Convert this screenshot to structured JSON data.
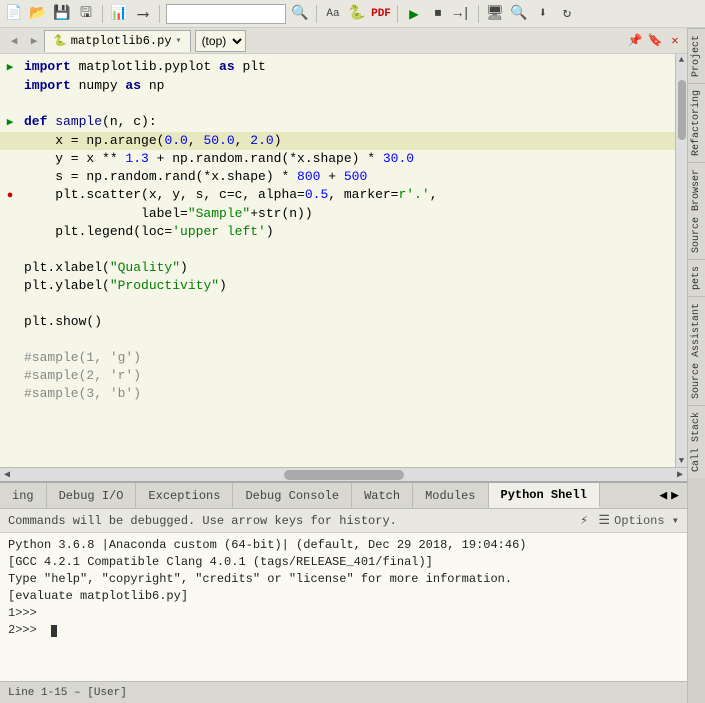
{
  "toolbar": {
    "search_placeholder": "",
    "file_tab": {
      "icon": "🐍",
      "name": "matplotlib6.py",
      "arrow": "▾",
      "scope": "(top)",
      "scope_arrow": "▾"
    },
    "tab_controls": {
      "pin": "📌",
      "bookmark": "🔖",
      "close": "✕"
    }
  },
  "code": {
    "lines": [
      {
        "num": "",
        "gutter": "▶",
        "gutter_type": "arrow",
        "content": "import matplotlib.pyplot as plt",
        "tokens": [
          {
            "t": "kw",
            "v": "import"
          },
          {
            "t": "plain",
            "v": " matplotlib.pyplot "
          },
          {
            "t": "kw",
            "v": "as"
          },
          {
            "t": "plain",
            "v": " plt"
          }
        ]
      },
      {
        "num": "",
        "gutter": "",
        "gutter_type": "",
        "content": "import numpy as np",
        "tokens": [
          {
            "t": "kw",
            "v": "import"
          },
          {
            "t": "plain",
            "v": " numpy "
          },
          {
            "t": "kw",
            "v": "as"
          },
          {
            "t": "plain",
            "v": " np"
          }
        ]
      },
      {
        "num": "",
        "gutter": "",
        "gutter_type": "",
        "content": "",
        "tokens": []
      },
      {
        "num": "▶",
        "gutter": "▶",
        "gutter_type": "arrow",
        "content": "def sample(n, c):",
        "tokens": [
          {
            "t": "kw",
            "v": "def"
          },
          {
            "t": "plain",
            "v": " "
          },
          {
            "t": "fn",
            "v": "sample"
          },
          {
            "t": "plain",
            "v": "(n, c):"
          }
        ]
      },
      {
        "num": "",
        "gutter": "",
        "gutter_type": "highlight",
        "content": "    x = np.arange(0.0, 50.0, 2.0)",
        "tokens": [
          {
            "t": "plain",
            "v": "    x = np.arange("
          },
          {
            "t": "num",
            "v": "0.0"
          },
          {
            "t": "plain",
            "v": ", "
          },
          {
            "t": "num",
            "v": "50.0"
          },
          {
            "t": "plain",
            "v": ", "
          },
          {
            "t": "num",
            "v": "2.0"
          },
          {
            "t": "plain",
            "v": ")"
          }
        ]
      },
      {
        "num": "",
        "gutter": "",
        "gutter_type": "",
        "content": "    y = x ** 1.3 + np.random.rand(*x.shape) * 30.0",
        "tokens": [
          {
            "t": "plain",
            "v": "    y = x ** "
          },
          {
            "t": "num",
            "v": "1.3"
          },
          {
            "t": "plain",
            "v": " + np.random.rand(*x.shape) * "
          },
          {
            "t": "num",
            "v": "30.0"
          }
        ]
      },
      {
        "num": "",
        "gutter": "",
        "gutter_type": "",
        "content": "    s = np.random.rand(*x.shape) * 800 + 500",
        "tokens": [
          {
            "t": "plain",
            "v": "    s = np.random.rand(*x.shape) * "
          },
          {
            "t": "num",
            "v": "800"
          },
          {
            "t": "plain",
            "v": " + "
          },
          {
            "t": "num",
            "v": "500"
          }
        ]
      },
      {
        "num": "●",
        "gutter": "●",
        "gutter_type": "breakpoint",
        "content": "    plt.scatter(x, y, s, c=c, alpha=0.5, marker=r'.','",
        "tokens": [
          {
            "t": "plain",
            "v": "    plt.scatter(x, y, s, c=c, alpha="
          },
          {
            "t": "num",
            "v": "0.5"
          },
          {
            "t": "plain",
            "v": ", marker="
          },
          {
            "t": "str",
            "v": "r'.'"
          },
          {
            "t": "plain",
            "v": ","
          }
        ]
      },
      {
        "num": "",
        "gutter": "",
        "gutter_type": "",
        "content": "                label=\"Sample\"+str(n))",
        "tokens": [
          {
            "t": "plain",
            "v": "                label="
          },
          {
            "t": "str",
            "v": "\"Sample\""
          },
          {
            "t": "plain",
            "v": "+str(n))"
          }
        ]
      },
      {
        "num": "",
        "gutter": "",
        "gutter_type": "",
        "content": "    plt.legend(loc='upper left')",
        "tokens": [
          {
            "t": "plain",
            "v": "    plt.legend(loc="
          },
          {
            "t": "str",
            "v": "'upper left'"
          },
          {
            "t": "plain",
            "v": ")"
          }
        ]
      },
      {
        "num": "",
        "gutter": "",
        "gutter_type": "",
        "content": "",
        "tokens": []
      },
      {
        "num": "",
        "gutter": "",
        "gutter_type": "",
        "content": "plt.xlabel(\"Quality\")",
        "tokens": [
          {
            "t": "plain",
            "v": "plt.xlabel("
          },
          {
            "t": "str",
            "v": "\"Quality\""
          },
          {
            "t": "plain",
            "v": ")"
          }
        ]
      },
      {
        "num": "",
        "gutter": "",
        "gutter_type": "",
        "content": "plt.ylabel(\"Productivity\")",
        "tokens": [
          {
            "t": "plain",
            "v": "plt.ylabel("
          },
          {
            "t": "str",
            "v": "\"Productivity\""
          },
          {
            "t": "plain",
            "v": ")"
          }
        ]
      },
      {
        "num": "",
        "gutter": "",
        "gutter_type": "",
        "content": "",
        "tokens": []
      },
      {
        "num": "",
        "gutter": "",
        "gutter_type": "",
        "content": "plt.show()",
        "tokens": [
          {
            "t": "plain",
            "v": "plt.show()"
          }
        ]
      },
      {
        "num": "",
        "gutter": "",
        "gutter_type": "",
        "content": "",
        "tokens": []
      },
      {
        "num": "",
        "gutter": "",
        "gutter_type": "",
        "content": "#sample(1, 'g')",
        "tokens": [
          {
            "t": "cm",
            "v": "#sample(1, 'g')"
          }
        ]
      },
      {
        "num": "",
        "gutter": "",
        "gutter_type": "",
        "content": "#sample(2, 'r')",
        "tokens": [
          {
            "t": "cm",
            "v": "#sample(2, 'r')"
          }
        ]
      },
      {
        "num": "",
        "gutter": "",
        "gutter_type": "",
        "content": "#sample(3, 'b')",
        "tokens": [
          {
            "t": "cm",
            "v": "#sample(3, 'b')"
          }
        ]
      }
    ]
  },
  "bottom_tabs": [
    {
      "id": "ing",
      "label": "ing",
      "active": false
    },
    {
      "id": "debug-io",
      "label": "Debug I/O",
      "active": false
    },
    {
      "id": "exceptions",
      "label": "Exceptions",
      "active": false
    },
    {
      "id": "debug-console",
      "label": "Debug Console",
      "active": false
    },
    {
      "id": "watch",
      "label": "Watch",
      "active": false
    },
    {
      "id": "modules",
      "label": "Modules",
      "active": false
    },
    {
      "id": "python-shell",
      "label": "Python Shell",
      "active": true
    }
  ],
  "console": {
    "toolbar_text": "Commands will be debugged.  Use arrow keys for history.",
    "output_lines": [
      "Python 3.6.8 |Anaconda custom (64-bit)| (default, Dec 29 2018, 19:04:46)",
      "[GCC 4.2.1 Compatible Clang 4.0.1 (tags/RELEASE_401/final)]",
      "Type \"help\", \"copyright\", \"credits\" or \"license\" for more information.",
      "[evaluate matplotlib6.py]"
    ],
    "prompt1": "1>>>",
    "prompt2": "2>>>"
  },
  "sidebar_right": {
    "panels": [
      "Project",
      "Refactoring",
      "Source Browser",
      "pets",
      "Source Assistant",
      "Call Stack"
    ]
  },
  "status_bar": {
    "text": "Line 1-15 – [User]"
  },
  "icons": {
    "new_file": "📄",
    "open": "📂",
    "save": "💾",
    "save_all": "🖫",
    "debug_chart": "📊",
    "step_over": "⟶",
    "run": "▶",
    "interrupt": "⏹",
    "step_in": "⬇",
    "monitor": "🖥",
    "search2": "🔍",
    "download": "⬇",
    "refresh": "↻",
    "bug": "🐛",
    "flame": "⚡",
    "list": "☰",
    "options": "Options"
  }
}
